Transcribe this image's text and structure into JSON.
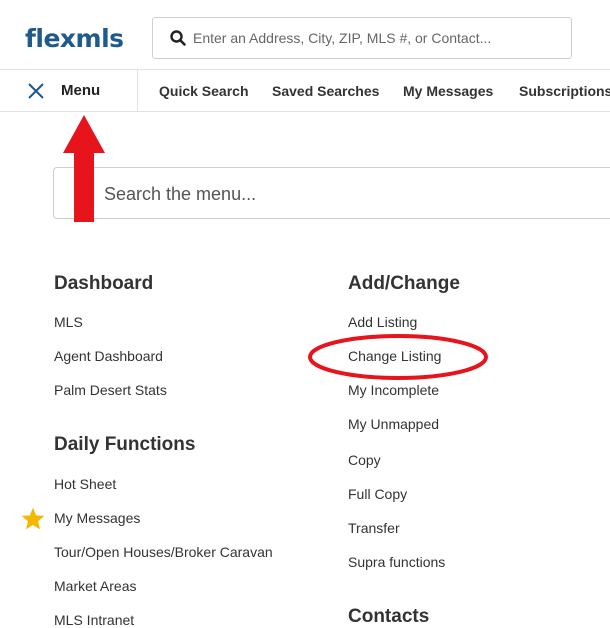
{
  "app": {
    "logo_text": "flexmls",
    "brand_color": "#1f5a8e"
  },
  "header": {
    "search_placeholder": "Enter an Address, City, ZIP, MLS #, or Contact...",
    "search_icon": "search-icon"
  },
  "nav": {
    "menu_label": "Menu",
    "links": [
      "Quick Search",
      "Saved Searches",
      "My Messages",
      "Subscriptions"
    ]
  },
  "menu_search": {
    "placeholder": "Search the menu..."
  },
  "sections": {
    "dashboard": {
      "title": "Dashboard",
      "items": [
        "MLS",
        "Agent Dashboard",
        "Palm Desert Stats"
      ]
    },
    "daily_functions": {
      "title": "Daily Functions",
      "items": [
        "Hot Sheet",
        "My Messages",
        "Tour/Open Houses/Broker Caravan",
        "Market Areas",
        "MLS Intranet"
      ]
    },
    "add_change": {
      "title": "Add/Change",
      "items": [
        "Add Listing",
        "Change Listing",
        "My Incomplete",
        "My Unmapped",
        "Copy",
        "Full Copy",
        "Transfer",
        "Supra functions"
      ]
    },
    "contacts": {
      "title": "Contacts"
    }
  },
  "annotations": {
    "arrow_color": "#e8141c",
    "circle_color": "#e8141c",
    "star_color": "#f5b800"
  }
}
